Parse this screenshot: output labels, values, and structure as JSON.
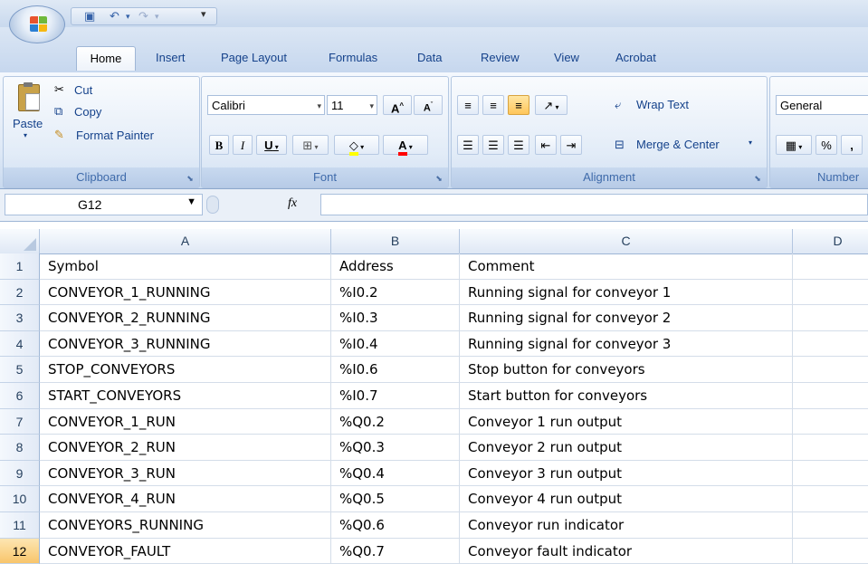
{
  "quick_access": {
    "save": "save-icon",
    "undo": "undo-icon",
    "redo": "redo-icon",
    "customize": "▾"
  },
  "tabs": [
    "Home",
    "Insert",
    "Page Layout",
    "Formulas",
    "Data",
    "Review",
    "View",
    "Acrobat"
  ],
  "clipboard": {
    "paste": "Paste",
    "cut": "Cut",
    "copy": "Copy",
    "format_painter": "Format Painter",
    "label": "Clipboard"
  },
  "font": {
    "name": "Calibri",
    "size": "11",
    "label": "Font",
    "bold": "B",
    "italic": "I",
    "underline": "U",
    "grow": "A",
    "shrink": "A"
  },
  "alignment": {
    "wrap_text": "Wrap Text",
    "merge_center": "Merge & Center",
    "label": "Alignment"
  },
  "number": {
    "format": "General",
    "percent": "%",
    "comma": ",",
    "label": "Number"
  },
  "formula_bar": {
    "cell_ref": "G12",
    "fx": "fx",
    "content": ""
  },
  "columns": [
    "A",
    "B",
    "C",
    "D"
  ],
  "rows": [
    {
      "n": "1",
      "a": "Symbol",
      "b": "Address",
      "c": "Comment"
    },
    {
      "n": "2",
      "a": "CONVEYOR_1_RUNNING",
      "b": "%I0.2",
      "c": "Running signal for conveyor 1"
    },
    {
      "n": "3",
      "a": "CONVEYOR_2_RUNNING",
      "b": "%I0.3",
      "c": "Running signal for conveyor 2"
    },
    {
      "n": "4",
      "a": "CONVEYOR_3_RUNNING",
      "b": "%I0.4",
      "c": "Running signal for conveyor 3"
    },
    {
      "n": "5",
      "a": "STOP_CONVEYORS",
      "b": "%I0.6",
      "c": "Stop button for conveyors"
    },
    {
      "n": "6",
      "a": "START_CONVEYORS",
      "b": "%I0.7",
      "c": "Start button for conveyors"
    },
    {
      "n": "7",
      "a": "CONVEYOR_1_RUN",
      "b": "%Q0.2",
      "c": "Conveyor 1 run output"
    },
    {
      "n": "8",
      "a": "CONVEYOR_2_RUN",
      "b": "%Q0.3",
      "c": "Conveyor 2 run output"
    },
    {
      "n": "9",
      "a": "CONVEYOR_3_RUN",
      "b": "%Q0.4",
      "c": "Conveyor 3 run output"
    },
    {
      "n": "10",
      "a": "CONVEYOR_4_RUN",
      "b": "%Q0.5",
      "c": "Conveyor 4 run output"
    },
    {
      "n": "11",
      "a": "CONVEYORS_RUNNING",
      "b": "%Q0.6",
      "c": "Conveyor run indicator"
    },
    {
      "n": "12",
      "a": "CONVEYOR_FAULT",
      "b": "%Q0.7",
      "c": "Conveyor fault indicator"
    }
  ],
  "selected_row": "12",
  "colors": {
    "accent": "#15428b",
    "selected_header": "#f8c56b",
    "highlight": "#ffff00",
    "font_red": "#ff0000"
  }
}
